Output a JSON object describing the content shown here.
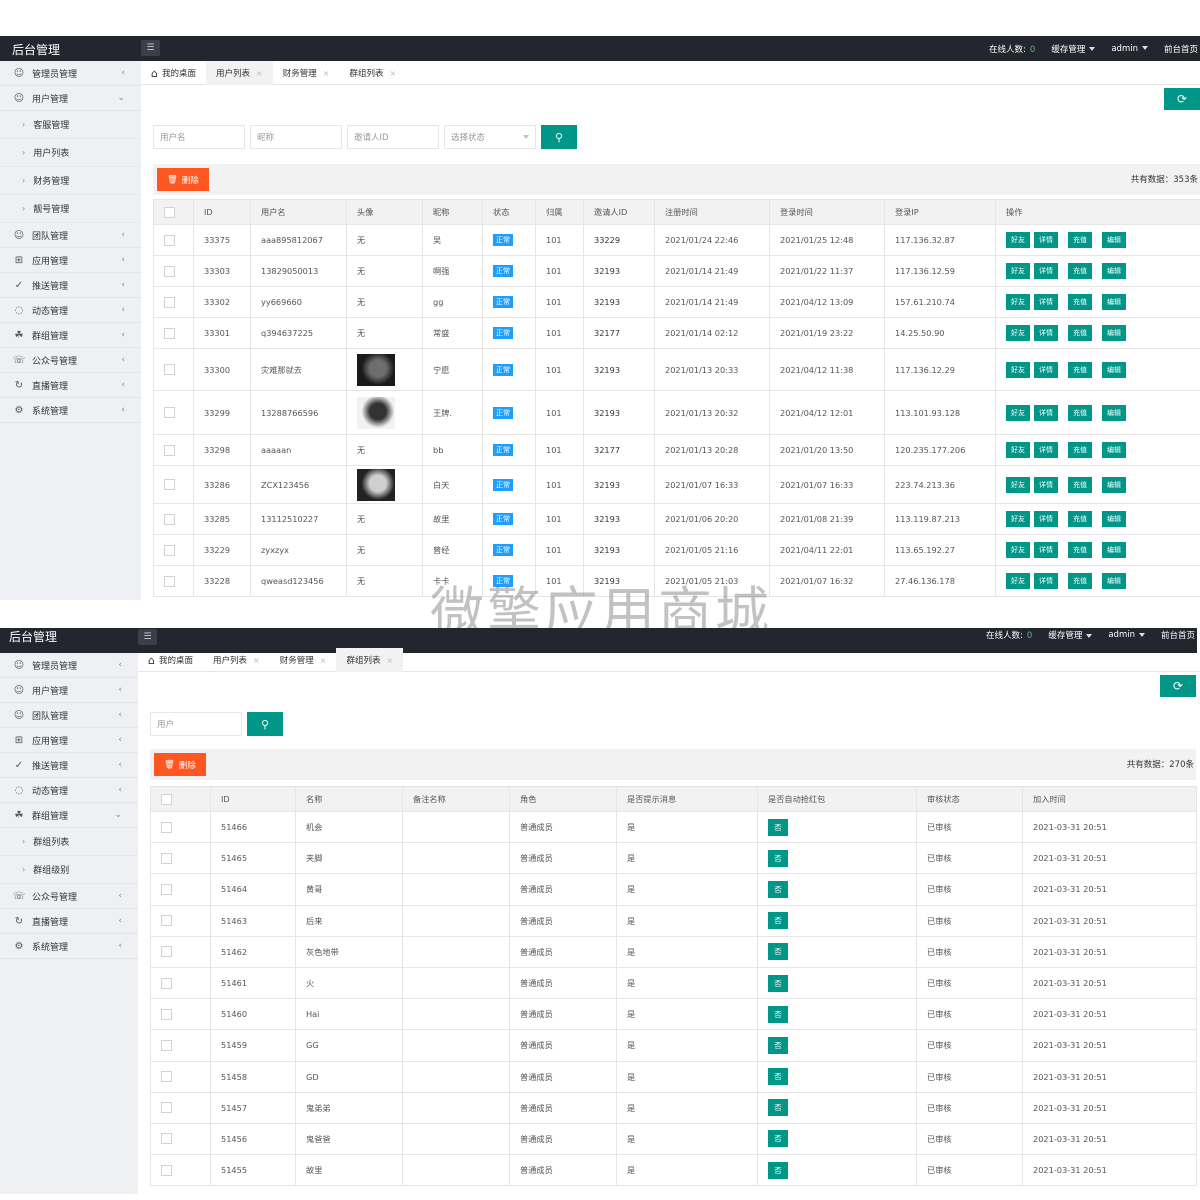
{
  "app": {
    "brand": "后台管理",
    "online_label": "在线人数:",
    "online_count": "0",
    "cache_menu": "缓存管理",
    "admin_menu": "admin",
    "frontend_link": "前台首页"
  },
  "panel1": {
    "sidebar": [
      {
        "label": "管理员管理",
        "icon": "user-admin-icon",
        "chev": "‹"
      },
      {
        "label": "用户管理",
        "icon": "user-icon",
        "chev": "⌄"
      },
      {
        "label": "客服管理",
        "sub": true
      },
      {
        "label": "用户列表",
        "sub": true
      },
      {
        "label": "财务管理",
        "sub": true
      },
      {
        "label": "靓号管理",
        "sub": true
      },
      {
        "label": "团队管理",
        "icon": "team-icon",
        "chev": "‹"
      },
      {
        "label": "应用管理",
        "icon": "apps-icon",
        "chev": "‹"
      },
      {
        "label": "推送管理",
        "icon": "push-icon",
        "chev": "‹"
      },
      {
        "label": "动态管理",
        "icon": "moments-icon",
        "chev": "‹"
      },
      {
        "label": "群组管理",
        "icon": "group-icon",
        "chev": "‹"
      },
      {
        "label": "公众号管理",
        "icon": "official-account-icon",
        "chev": "‹"
      },
      {
        "label": "直播管理",
        "icon": "live-icon",
        "chev": "‹"
      },
      {
        "label": "系统管理",
        "icon": "settings-icon",
        "chev": "‹"
      }
    ],
    "tabs": [
      {
        "label": "我的桌面",
        "home": true
      },
      {
        "label": "用户列表",
        "active": true,
        "x": "×"
      },
      {
        "label": "财务管理",
        "x": "×"
      },
      {
        "label": "群组列表",
        "x": "×"
      }
    ],
    "search": {
      "username": "用户名",
      "nickname": "昵称",
      "inviter": "邀请人ID",
      "status": "选择状态"
    },
    "delete_label": "删除",
    "total": "共有数据：353条",
    "columns": [
      "",
      "ID",
      "用户名",
      "头像",
      "昵称",
      "状态",
      "归属",
      "邀请人ID",
      "注册时间",
      "登录时间",
      "登录IP",
      "操作"
    ],
    "actions": [
      "好友",
      "详情",
      "充值",
      "编辑"
    ],
    "rows": [
      {
        "id": "33375",
        "username": "aaa895812067",
        "avatar": "无",
        "nickname": "吴",
        "status": "正常",
        "belong": "101",
        "inviter": "33229",
        "reg": "2021/01/24 22:46",
        "login": "2021/01/25 12:48",
        "ip": "117.136.32.87"
      },
      {
        "id": "33303",
        "username": "13829050013",
        "avatar": "无",
        "nickname": "啊强",
        "status": "正常",
        "belong": "101",
        "inviter": "32193",
        "reg": "2021/01/14 21:49",
        "login": "2021/01/22 11:37",
        "ip": "117.136.12.59"
      },
      {
        "id": "33302",
        "username": "yy669660",
        "avatar": "无",
        "nickname": "gg",
        "status": "正常",
        "belong": "101",
        "inviter": "32193",
        "reg": "2021/01/14 21:49",
        "login": "2021/04/12 13:09",
        "ip": "157.61.210.74"
      },
      {
        "id": "33301",
        "username": "q394637225",
        "avatar": "无",
        "nickname": "常盛",
        "status": "正常",
        "belong": "101",
        "inviter": "32177",
        "reg": "2021/01/14 02:12",
        "login": "2021/01/19 23:22",
        "ip": "14.25.50.90"
      },
      {
        "id": "33300",
        "username": "灾难那就去",
        "avatar": "img",
        "nickname": "宁愿",
        "status": "正常",
        "belong": "101",
        "inviter": "32193",
        "reg": "2021/01/13 20:33",
        "login": "2021/04/12 11:38",
        "ip": "117.136.12.29"
      },
      {
        "id": "33299",
        "username": "13288766596",
        "avatar": "img",
        "nickname": "王牌.",
        "status": "正常",
        "belong": "101",
        "inviter": "32193",
        "reg": "2021/01/13 20:32",
        "login": "2021/04/12 12:01",
        "ip": "113.101.93.128"
      },
      {
        "id": "33298",
        "username": "aaaaan",
        "avatar": "无",
        "nickname": "bb",
        "status": "正常",
        "belong": "101",
        "inviter": "32177",
        "reg": "2021/01/13 20:28",
        "login": "2021/01/20 13:50",
        "ip": "120.235.177.206"
      },
      {
        "id": "33286",
        "username": "ZCX123456",
        "avatar": "img",
        "nickname": "白天",
        "status": "正常",
        "belong": "101",
        "inviter": "32193",
        "reg": "2021/01/07 16:33",
        "login": "2021/01/07 16:33",
        "ip": "223.74.213.36"
      },
      {
        "id": "33285",
        "username": "13112510227",
        "avatar": "无",
        "nickname": "故里",
        "status": "正常",
        "belong": "101",
        "inviter": "32193",
        "reg": "2021/01/06 20:20",
        "login": "2021/01/08 21:39",
        "ip": "113.119.87.213"
      },
      {
        "id": "33229",
        "username": "zyxzyx",
        "avatar": "无",
        "nickname": "曾经",
        "status": "正常",
        "belong": "101",
        "inviter": "32193",
        "reg": "2021/01/05 21:16",
        "login": "2021/04/11 22:01",
        "ip": "113.65.192.27"
      },
      {
        "id": "33228",
        "username": "qweasd123456",
        "avatar": "无",
        "nickname": "卡卡",
        "status": "正常",
        "belong": "101",
        "inviter": "32193",
        "reg": "2021/01/05 21:03",
        "login": "2021/01/07 16:32",
        "ip": "27.46.136.178"
      }
    ]
  },
  "watermark": "微擎应用商城",
  "panel2": {
    "sidebar": [
      {
        "label": "管理员管理",
        "icon": "user-admin-icon",
        "chev": "‹"
      },
      {
        "label": "用户管理",
        "icon": "user-icon",
        "chev": "‹"
      },
      {
        "label": "团队管理",
        "icon": "team-icon",
        "chev": "‹"
      },
      {
        "label": "应用管理",
        "icon": "apps-icon",
        "chev": "‹"
      },
      {
        "label": "推送管理",
        "icon": "push-icon",
        "chev": "‹"
      },
      {
        "label": "动态管理",
        "icon": "moments-icon",
        "chev": "‹"
      },
      {
        "label": "群组管理",
        "icon": "group-icon",
        "chev": "⌄"
      },
      {
        "label": "群组列表",
        "sub": true
      },
      {
        "label": "群组级别",
        "sub": true
      },
      {
        "label": "公众号管理",
        "icon": "official-account-icon",
        "chev": "‹"
      },
      {
        "label": "直播管理",
        "icon": "live-icon",
        "chev": "‹"
      },
      {
        "label": "系统管理",
        "icon": "settings-icon",
        "chev": "‹"
      }
    ],
    "tabs": [
      {
        "label": "我的桌面",
        "home": true
      },
      {
        "label": "用户列表",
        "x": "×"
      },
      {
        "label": "财务管理",
        "x": "×"
      },
      {
        "label": "群组列表",
        "active": true,
        "x": "×"
      }
    ],
    "search": {
      "user": "用户"
    },
    "delete_label": "删除",
    "total": "共有数据：270条",
    "columns": [
      "",
      "ID",
      "名称",
      "备注名称",
      "角色",
      "是否提示消息",
      "是否自动抢红包",
      "审核状态",
      "加入时间"
    ],
    "rows": [
      {
        "id": "51466",
        "name": "机会",
        "remark": "",
        "role": "普通成员",
        "notify": "是",
        "auto": "否",
        "audit": "已审核",
        "joined": "2021-03-31 20:51"
      },
      {
        "id": "51465",
        "name": "夹脚",
        "remark": "",
        "role": "普通成员",
        "notify": "是",
        "auto": "否",
        "audit": "已审核",
        "joined": "2021-03-31 20:51"
      },
      {
        "id": "51464",
        "name": "黄哥",
        "remark": "",
        "role": "普通成员",
        "notify": "是",
        "auto": "否",
        "audit": "已审核",
        "joined": "2021-03-31 20:51"
      },
      {
        "id": "51463",
        "name": "后来",
        "remark": "",
        "role": "普通成员",
        "notify": "是",
        "auto": "否",
        "audit": "已审核",
        "joined": "2021-03-31 20:51"
      },
      {
        "id": "51462",
        "name": "灰色地带",
        "remark": "",
        "role": "普通成员",
        "notify": "是",
        "auto": "否",
        "audit": "已审核",
        "joined": "2021-03-31 20:51"
      },
      {
        "id": "51461",
        "name": "火",
        "remark": "",
        "role": "普通成员",
        "notify": "是",
        "auto": "否",
        "audit": "已审核",
        "joined": "2021-03-31 20:51"
      },
      {
        "id": "51460",
        "name": "Hai",
        "remark": "",
        "role": "普通成员",
        "notify": "是",
        "auto": "否",
        "audit": "已审核",
        "joined": "2021-03-31 20:51"
      },
      {
        "id": "51459",
        "name": "GG",
        "remark": "",
        "role": "普通成员",
        "notify": "是",
        "auto": "否",
        "audit": "已审核",
        "joined": "2021-03-31 20:51"
      },
      {
        "id": "51458",
        "name": "GD",
        "remark": "",
        "role": "普通成员",
        "notify": "是",
        "auto": "否",
        "audit": "已审核",
        "joined": "2021-03-31 20:51"
      },
      {
        "id": "51457",
        "name": "鬼弟弟",
        "remark": "",
        "role": "普通成员",
        "notify": "是",
        "auto": "否",
        "audit": "已审核",
        "joined": "2021-03-31 20:51"
      },
      {
        "id": "51456",
        "name": "鬼爸爸",
        "remark": "",
        "role": "普通成员",
        "notify": "是",
        "auto": "否",
        "audit": "已审核",
        "joined": "2021-03-31 20:51"
      },
      {
        "id": "51455",
        "name": "故里",
        "remark": "",
        "role": "普通成员",
        "notify": "是",
        "auto": "否",
        "audit": "已审核",
        "joined": "2021-03-31 20:51"
      }
    ]
  },
  "colors": {
    "topbar": "#23262e",
    "primary": "#009688",
    "danger": "#ff5722",
    "status_blue": "#1e9fff"
  }
}
